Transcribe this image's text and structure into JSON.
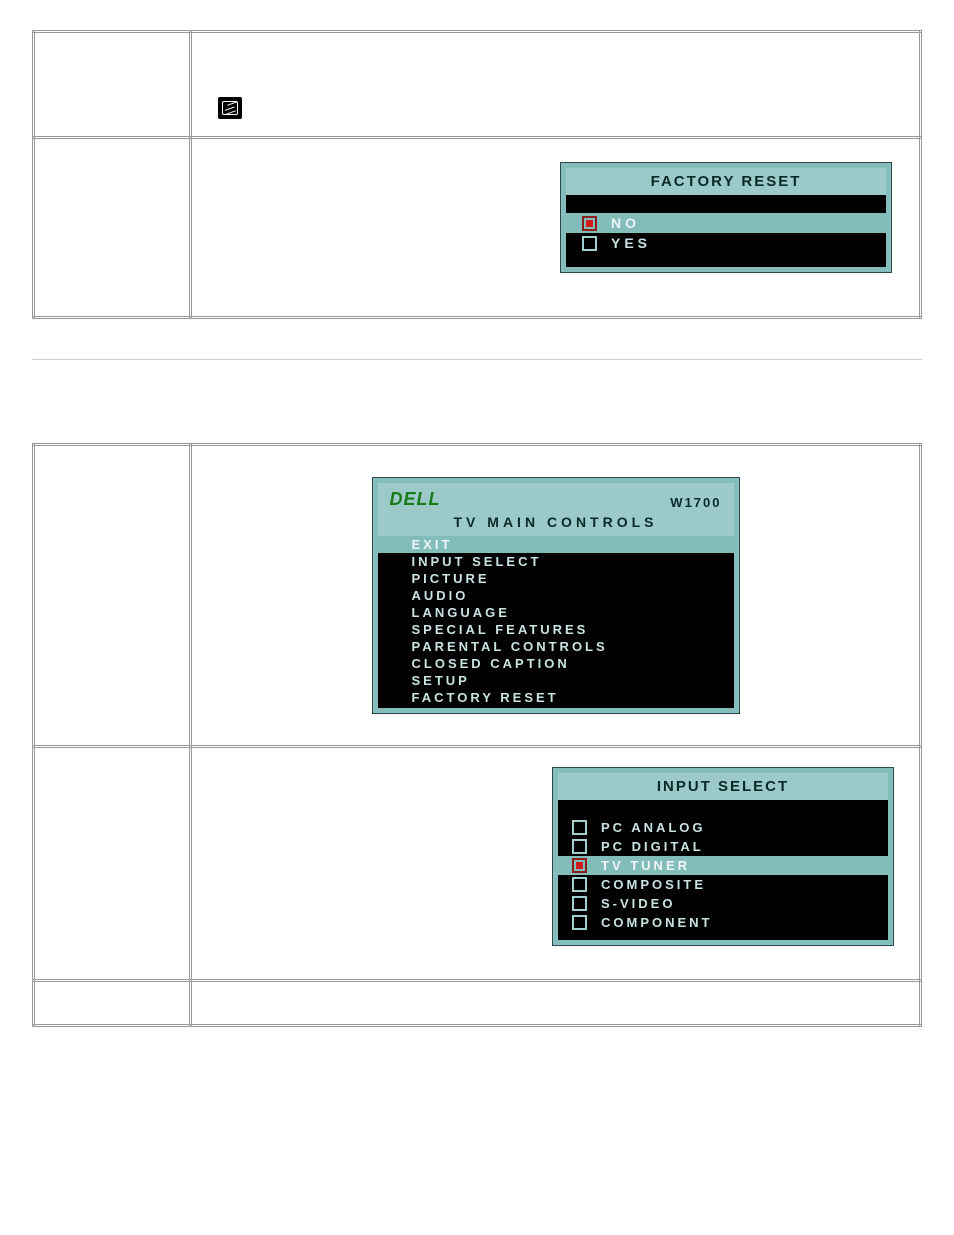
{
  "factory_reset_panel": {
    "title": "FACTORY RESET",
    "options": [
      {
        "label": "NO",
        "selected": true
      },
      {
        "label": "YES",
        "selected": false
      }
    ]
  },
  "tv_main_controls": {
    "brand": "DELL",
    "model": "W1700",
    "title": "TV MAIN CONTROLS",
    "items": [
      {
        "label": "EXIT",
        "highlight": true
      },
      {
        "label": "INPUT SELECT",
        "highlight": false
      },
      {
        "label": "PICTURE",
        "highlight": false
      },
      {
        "label": "AUDIO",
        "highlight": false
      },
      {
        "label": "LANGUAGE",
        "highlight": false
      },
      {
        "label": "SPECIAL FEATURES",
        "highlight": false
      },
      {
        "label": "PARENTAL CONTROLS",
        "highlight": false
      },
      {
        "label": "CLOSED CAPTION",
        "highlight": false
      },
      {
        "label": "SETUP",
        "highlight": false
      },
      {
        "label": "FACTORY RESET",
        "highlight": false
      }
    ]
  },
  "input_select_panel": {
    "title": "INPUT SELECT",
    "options": [
      {
        "label": "PC ANALOG",
        "selected": false
      },
      {
        "label": "PC DIGITAL",
        "selected": false
      },
      {
        "label": "TV TUNER",
        "selected": true
      },
      {
        "label": "COMPOSITE",
        "selected": false
      },
      {
        "label": "S-VIDEO",
        "selected": false
      },
      {
        "label": "COMPONENT",
        "selected": false
      }
    ]
  }
}
